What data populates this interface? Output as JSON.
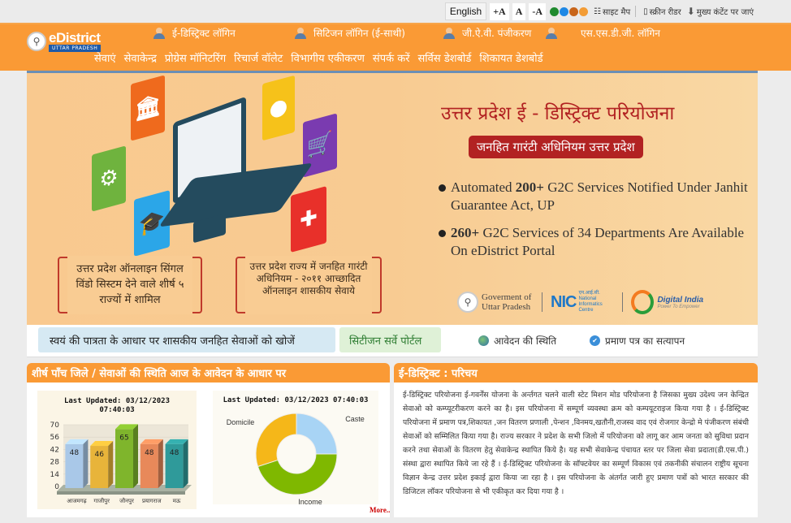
{
  "topbar": {
    "language": "English",
    "font_increase": "+A",
    "font_normal": "A",
    "font_decrease": "-A",
    "theme_colors": [
      "#1f8a2e",
      "#1e88e5",
      "#c8651a",
      "#f39c35"
    ],
    "sitemap": "साइट मैप",
    "screen_reader": "स्क्रीन रीडर",
    "skip_to_content": "मुख्य कंटेंट पर जाएं"
  },
  "header": {
    "logo_title": "eDistrict",
    "logo_subtitle": "UTTAR PRADESH",
    "logins": [
      {
        "label": "ई-डिस्ट्रिक्ट लॉगिन",
        "icon": "officer-icon"
      },
      {
        "label": "सिटिजन लॉगिन (ई-साथी)",
        "icon": "citizen-icon"
      },
      {
        "label": "जी.ऐ.वी. पंजीकरण",
        "icon": "user-icon"
      },
      {
        "label": "एस.एस.डी.जी. लॉगिन",
        "icon": "officer-icon"
      }
    ],
    "nav": [
      "सेवाएं",
      "सेवाकेन्द्र",
      "प्रोग्रेस मॉनिटरिंग",
      "रिचार्ज वॉलेट",
      "विभागीय एकीकरण",
      "संपर्क करें",
      "सर्विस डेशबोर्ड",
      "शिकायत डेशबोर्ड"
    ]
  },
  "banner": {
    "title": "उत्तर प्रदेश ई - डिस्ट्रिक्ट परियोजना",
    "subtitle": "जनहित गारंटी अधिनियम उत्तर प्रदेश",
    "bullet1_bold": "200+",
    "bullet1_pre": "Automated ",
    "bullet1_post": " G2C Services Notified Under Janhit Guarantee Act, UP",
    "bullet2_bold": "260+",
    "bullet2_post": " G2C Services of 34 Departments Are Available On eDistrict Portal",
    "box1": "उत्तर प्रदेश ऑनलाइन सिंगल विंडो सिस्टम देने वाले शीर्ष ५ राज्यों में शामिल",
    "box2": "उत्तर प्रदेश राज्य में जनहित गारंटी अधिनियम - २०११ आच्छादित ऑनलाइन शासकीय सेवाये",
    "gov_logo": "Goverment of Uttar Pradesh",
    "nic_logo": "NIC",
    "nic_sub": "एन.आई.सी. National Informatics Centre",
    "digital_india": "Digital India",
    "digital_india_sub": "Power To Empower"
  },
  "strip": {
    "search_services": "स्वयं की पात्रता के आधार पर शासकीय जनहित सेवाओं को खोजें",
    "citizen_survey": "सिटीजन सर्वे पोर्टल",
    "application_status": "आवेदन की स्थिति",
    "certificate_verify": "प्रमाण पत्र का सत्यापन"
  },
  "left_panel": {
    "title": "शीर्ष पाँच जिले / सेवाओं की स्थिति आज के आवेदन के आधार पर",
    "more": "More.."
  },
  "right_panel": {
    "title": "ई-डिस्ट्रिक्ट : परिचय",
    "text": "ई-डिस्ट्रिक्ट परियोजना ई-गवर्नेंस योजना के अर्न्तगत चलने वाली स्टेट मिशन मोड परियोजना है जिसका मुख्य उदेश्य जन केन्द्रित सेवाओ को कम्प्यूटरीकरण करने का है। इस परियोजना में सम्पूर्ण व्यवस्था क्रम को कम्पयूटराइज किया गया है । ई-डिस्ट्रिक्ट परियोजना में प्रमाण पत्र,शिकायत ,जन वितरण प्रणाली ,पेन्शन ,विनमय,खतौनी,राजस्व वाद एवं रोजगार केन्द्रो मे पंजीकरण संबंधी सेवाओं को सम्मिलित किया गया है। राज्य सरकार ने प्रदेश के सभी जिलो में परियोजना को लागू कर आम जनता को सुविधा प्रदान करने तथा सेवाओं के वितरण हेतु सेवाकेन्द्र स्थापित किये है। यह सभी सेवाकेन्द्र पंचायत स्तर पर जिला सेवा प्रदाता(डी.एस.पी.) संस्था द्वारा स्थापित किये जा रहे हैं । ई-डिस्ट्रिक्ट परियोजना के सॉफ्टवेयर का सम्पूर्ण विकास एवं तकनीकी संचालन राष्ट्रीय सूचना विज्ञान केन्द्र उत्तर प्रदेश इकाई द्वारा किया जा रहा है । इस परियोजना के अंतर्गत जारी हुए प्रमाण पत्रों को भारत सरकार की डिजिटल लॉकर परियोजना से भी एकीकृत कर दिया गया है ।"
  },
  "chart_data": [
    {
      "type": "bar",
      "title": "Last Updated: 03/12/2023 07:40:03",
      "categories": [
        "आजमगढ़",
        "गाजीपुर",
        "जौनपुर",
        "प्रयागराज",
        "मऊ"
      ],
      "values": [
        48,
        46,
        65,
        48,
        48
      ],
      "colors": [
        "#a9c8e8",
        "#e8b43a",
        "#7fb52c",
        "#e8895a",
        "#2f9a9a"
      ],
      "yticks": [
        0,
        14,
        28,
        42,
        56,
        70
      ],
      "ylim": [
        0,
        70
      ],
      "xlabel": "",
      "ylabel": "",
      "grid": true
    },
    {
      "type": "pie",
      "title": "Last Updated: 03/12/2023 07:40:03",
      "labels": [
        "Caste",
        "Income",
        "Domicile"
      ],
      "values": [
        25,
        45,
        30
      ],
      "colors": [
        "#a8d4f5",
        "#7fb800",
        "#f5b719"
      ],
      "donut": true
    }
  ]
}
